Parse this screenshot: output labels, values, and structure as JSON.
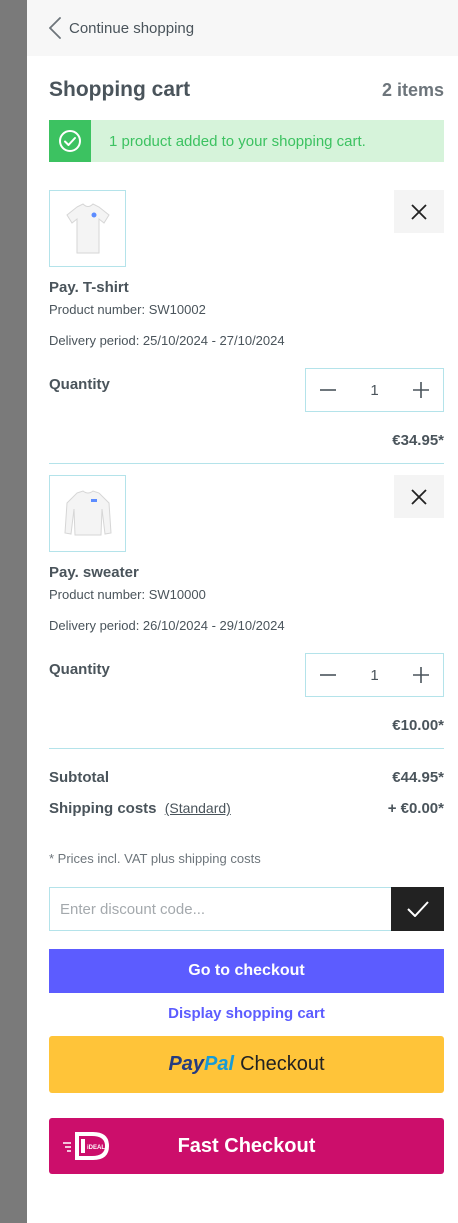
{
  "nav": {
    "back_label": "Continue shopping"
  },
  "cart": {
    "title": "Shopping cart",
    "count_label": "2 items"
  },
  "alert": {
    "message": "1 product added to your shopping cart."
  },
  "items": [
    {
      "name": "Pay. T-shirt",
      "product_number": "Product number: SW10002",
      "delivery": "Delivery period: 25/10/2024 - 27/10/2024",
      "quantity_label": "Quantity",
      "quantity": "1",
      "price": "€34.95*",
      "image": "tshirt-icon"
    },
    {
      "name": "Pay. sweater",
      "product_number": "Product number: SW10000",
      "delivery": "Delivery period: 26/10/2024 - 29/10/2024",
      "quantity_label": "Quantity",
      "quantity": "1",
      "price": "€10.00*",
      "image": "sweater-icon"
    }
  ],
  "totals": {
    "subtotal_label": "Subtotal",
    "subtotal_value": "€44.95*",
    "shipping_label": "Shipping costs",
    "shipping_method": "(Standard)",
    "shipping_value": "+ €0.00*"
  },
  "note": "* Prices incl. VAT plus shipping costs",
  "discount": {
    "placeholder": "Enter discount code..."
  },
  "actions": {
    "checkout": "Go to checkout",
    "display_cart": "Display shopping cart",
    "paypal_pay": "Pay",
    "paypal_pal": "Pal",
    "paypal_checkout": "Checkout",
    "fast_checkout": "Fast Checkout",
    "ideal_logo_text": "iDEAL"
  },
  "colors": {
    "accent": "#5c5cff",
    "success": "#3cc261",
    "paypal": "#ffc439",
    "ideal": "#cc0e6b"
  }
}
